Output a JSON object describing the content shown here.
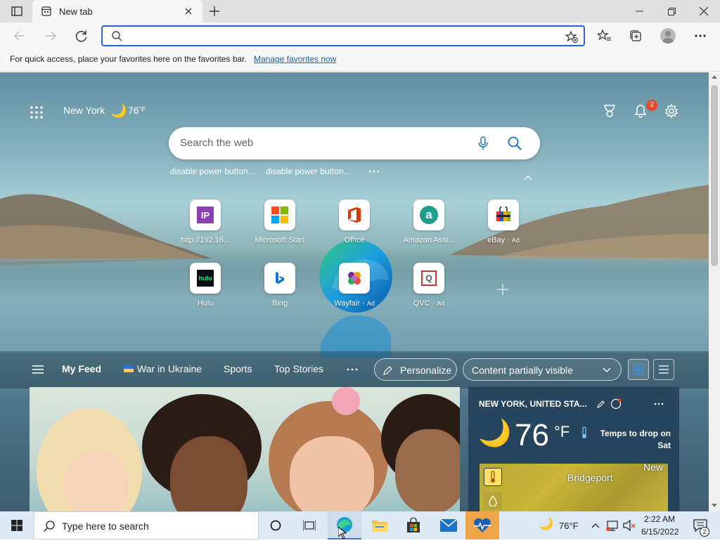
{
  "tab": {
    "title": "New tab"
  },
  "favorites_bar": {
    "text": "For quick access, place your favorites here on the favorites bar.",
    "link": "Manage favorites now"
  },
  "ntp": {
    "city": "New York",
    "temp": "76",
    "temp_unit": "°F",
    "notifications": "2",
    "search_placeholder": "Search the web",
    "recent_searches": [
      "disable power button...",
      "disable power button..."
    ],
    "quick_links": [
      {
        "label": "http://192.16..."
      },
      {
        "label": "Microsoft Start"
      },
      {
        "label": "Office"
      },
      {
        "label": "Amazon Assi..."
      },
      {
        "label": "eBay",
        "ad": "Ad"
      },
      {
        "label": "Hulu"
      },
      {
        "label": "Bing"
      },
      {
        "label": "Wayfair",
        "ad": "Ad"
      },
      {
        "label": "QVC",
        "ad": "Ad"
      }
    ]
  },
  "feed": {
    "tabs": [
      "My Feed",
      "War in Ukraine",
      "Sports",
      "Top Stories"
    ],
    "personalize": "Personalize",
    "content_select": "Content partially visible"
  },
  "weather_card": {
    "location": "NEW YORK, UNITED STA...",
    "temp": "76",
    "unit": "°F",
    "note": "Temps to drop on Sat",
    "map_label_1": "New",
    "map_label_2": "Bridgeport"
  },
  "taskbar": {
    "search_placeholder": "Type here to search",
    "weather_temp": "76°F",
    "time": "2:22 AM",
    "date": "6/15/2022",
    "notification_count": "2"
  },
  "colors": {
    "accent": "#2b64c8",
    "link": "#1a5fb4",
    "badge": "#e8492e"
  }
}
